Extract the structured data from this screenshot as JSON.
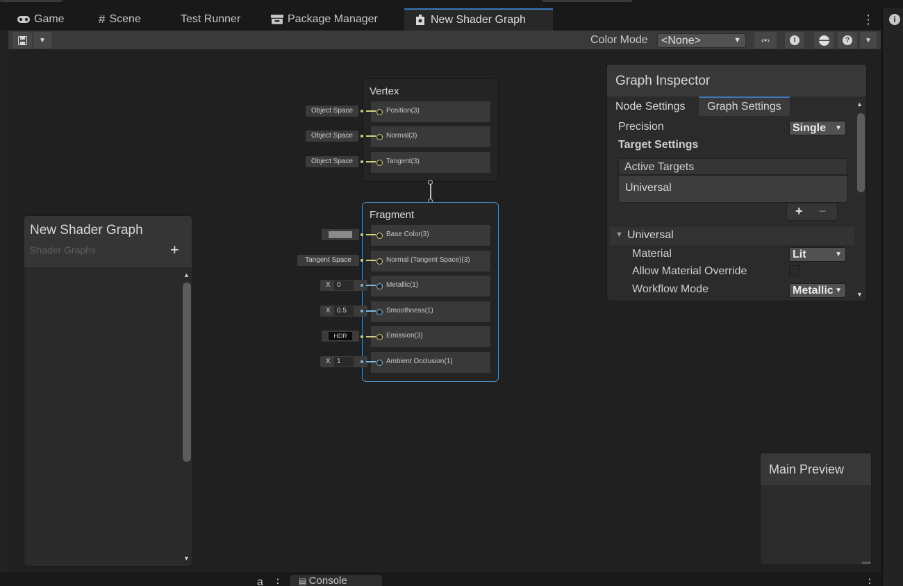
{
  "tabs": [
    {
      "label": "Game",
      "icon": "gamepad-icon"
    },
    {
      "label": "Scene",
      "icon": "grid-hash-icon"
    },
    {
      "label": "Test Runner",
      "icon": ""
    },
    {
      "label": "Package Manager",
      "icon": "package-icon"
    },
    {
      "label": "New Shader Graph",
      "icon": "shader-graph-icon",
      "active": true
    }
  ],
  "toolbar": {
    "color_mode_label": "Color Mode",
    "color_mode_value": "<None>"
  },
  "vertex": {
    "title": "Vertex",
    "slots": [
      {
        "label": "Position(3)",
        "input": "Object Space"
      },
      {
        "label": "Normal(3)",
        "input": "Object Space"
      },
      {
        "label": "Tangent(3)",
        "input": "Object Space"
      }
    ]
  },
  "fragment": {
    "title": "Fragment",
    "slots": [
      {
        "label": "Base Color(3)",
        "input": ""
      },
      {
        "label": "Normal (Tangent Space)(3)",
        "input": "Tangent Space"
      },
      {
        "label": "Metallic(1)",
        "input_axis": "X",
        "input": "0"
      },
      {
        "label": "Smoothness(1)",
        "input_axis": "X",
        "input": "0.5"
      },
      {
        "label": "Emission(3)",
        "input": "HDR"
      },
      {
        "label": "Ambient Occlusion(1)",
        "input_axis": "X",
        "input": "1"
      }
    ]
  },
  "blackboard": {
    "title": "New Shader Graph",
    "subtitle": "Shader Graphs",
    "add_label": "+"
  },
  "inspector": {
    "title": "Graph Inspector",
    "tabs": [
      "Node Settings",
      "Graph Settings"
    ],
    "precision_label": "Precision",
    "precision_value": "Single",
    "target_settings_label": "Target Settings",
    "active_targets_label": "Active Targets",
    "active_target_item": "Universal",
    "add_symbol": "+",
    "remove_symbol": "−",
    "universal_section": "Universal",
    "material_label": "Material",
    "material_value": "Lit",
    "allow_override_label": "Allow Material Override",
    "workflow_label": "Workflow Mode",
    "workflow_value": "Metallic"
  },
  "main_preview": {
    "title": "Main Preview"
  },
  "bottom": {
    "console_label": "Console"
  },
  "colors": {
    "accent": "#3a79bb",
    "wire_vector3": "#d0d080",
    "wire_float": "#7fb5d9"
  }
}
